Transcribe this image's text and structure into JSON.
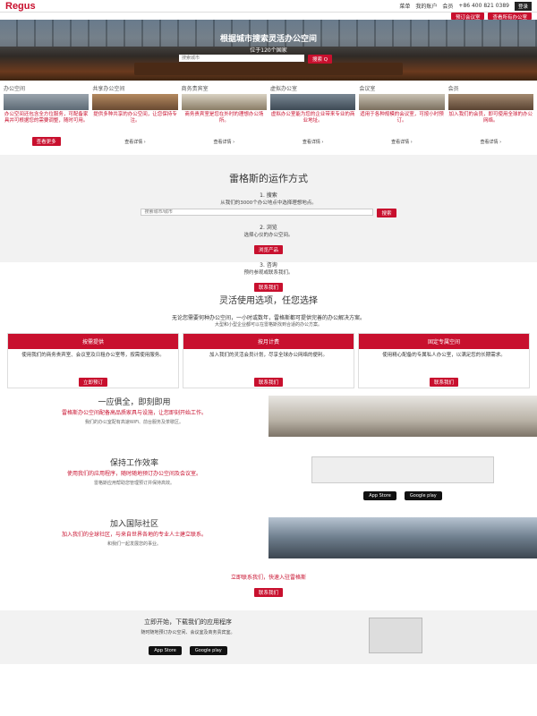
{
  "header": {
    "logo": "Regus",
    "links": [
      "菜单",
      "我的账户",
      "会员",
      "+86 400 821 0389"
    ],
    "login": "登录",
    "sub_buttons": [
      "预订会议室",
      "查看所有办公室"
    ]
  },
  "hero": {
    "title": "根据城市搜索灵活办公空间",
    "subtitle": "位于120个国家",
    "search_placeholder": "搜索城市",
    "search_button": "搜索 Q"
  },
  "cards": [
    {
      "title": "办公空间",
      "desc": "办公空间还包含全方位服务，可配备家具并可根据您的需要调整，随时可用。",
      "cta": "查看更多"
    },
    {
      "title": "共享办公空间",
      "desc": "提供多种共享的办公空间，让您保持专注。",
      "cta": "查看详情 ›"
    },
    {
      "title": "商务贵宾室",
      "desc": "商务贵宾室是您在外时的理想办公场所。",
      "cta": "查看详情 ›"
    },
    {
      "title": "虚拟办公室",
      "desc": "虚拟办公室能为您的企业带来专业的商业地址。",
      "cta": "查看详情 ›"
    },
    {
      "title": "会议室",
      "desc": "适用于各种规模的会议室，可按小时预订。",
      "cta": "查看详情 ›"
    },
    {
      "title": "会员",
      "desc": "加入我们的会员，即可使用全球的办公网络。",
      "cta": "查看详情 ›"
    }
  ],
  "how": {
    "title": "雷格斯的运作方式",
    "step1": "1. 搜索",
    "step1_sub": "从我们的3000个办公地点中选择理想地点。",
    "step1_placeholder": "搜索城市/城市",
    "step1_button": "搜索",
    "step2": "2. 浏览",
    "step2_sub": "选择心仪的办公空间。",
    "step2_button": "浏览产品",
    "step3": "3. 咨询",
    "step3_sub": "预约参观或联系我们。",
    "step3_button": "联系我们"
  },
  "flex": {
    "title": "灵活使用选项，任您选择",
    "sub1": "无论您需要何种办公空间，一小时或数年，雷格斯都可提供完善的办公解决方案。",
    "sub2": "大型和小型企业都可以在雷格斯找到合适的办公方案。",
    "options": [
      {
        "title": "按需提供",
        "desc": "使用我们的商务贵宾室、会议室及日租办公室等，按需使用服务。",
        "cta": "立即预订"
      },
      {
        "title": "按月计费",
        "desc": "加入我们的灵活会员计划，尽享全球办公网络的便利。",
        "cta": "联系我们"
      },
      {
        "title": "固定专属空间",
        "desc": "使用精心配备的专属私人办公室，以满足您的长期需求。",
        "cta": "联系我们"
      }
    ]
  },
  "f1": {
    "title": "一应俱全，即刻即用",
    "red": "雷格斯办公空间配备高品质家具与设施，让您即刻开始工作。",
    "gray": "我们的办公室配有高速WiFi、前台服务及茶歇区。"
  },
  "f2": {
    "title": "保持工作效率",
    "red": "使用我们的应用程序，随时随地预订办公空间及会议室。",
    "gray": "雷格斯应用帮助您管理预订并保持高效。",
    "store1": "App Store",
    "store2": "Google play"
  },
  "f3": {
    "title": "加入国际社区",
    "red": "加入我们的全球社区，与来自世界各地的专业人士建立联系。",
    "gray": "和我们一起发展您的事业。",
    "contact": "立即联系我们，快速入驻雷格斯",
    "cta": "联系我们"
  },
  "bottom": {
    "title": "立即开始，下载我们的应用程序",
    "desc": "随时随地预订办公空间、会议室及商务贵宾室。",
    "store1": "App Store",
    "store2": "Google play"
  }
}
